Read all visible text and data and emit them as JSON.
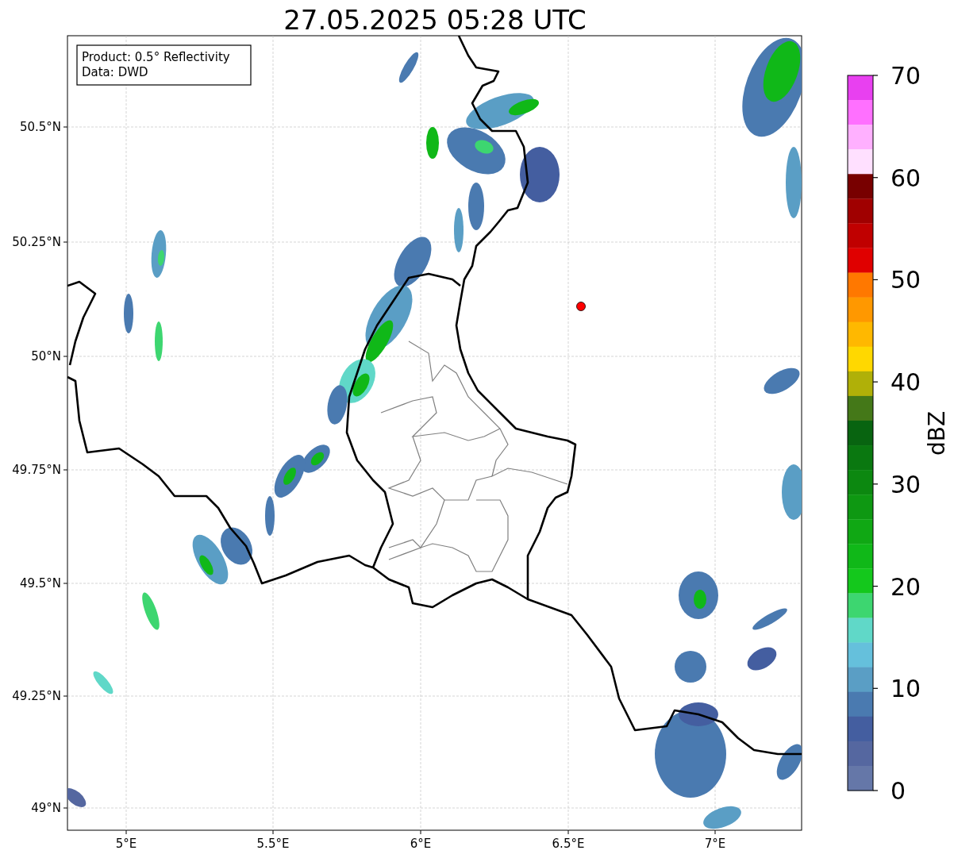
{
  "title": "27.05.2025 05:28 UTC",
  "info_box": {
    "lines": [
      "Product: 0.5° Reflectivity",
      "Data: DWD"
    ]
  },
  "x_ticks": [
    "5°E",
    "5.5°E",
    "6°E",
    "6.5°E",
    "7°E"
  ],
  "y_ticks": [
    "50.5°N",
    "50.25°N",
    "50°N",
    "49.75°N",
    "49.5°N",
    "49.25°N",
    "49°N"
  ],
  "colorbar": {
    "label": "dBZ",
    "ticks": [
      "70",
      "60",
      "50",
      "40",
      "30",
      "20",
      "10",
      "0"
    ],
    "bins": [
      {
        "color": "#e840f0"
      },
      {
        "color": "#ff70ff"
      },
      {
        "color": "#ffb0ff"
      },
      {
        "color": "#ffe0ff"
      },
      {
        "color": "#780000"
      },
      {
        "color": "#a00000"
      },
      {
        "color": "#c00000"
      },
      {
        "color": "#e00000"
      },
      {
        "color": "#ff7800"
      },
      {
        "color": "#ff9800"
      },
      {
        "color": "#ffb800"
      },
      {
        "color": "#ffd800"
      },
      {
        "color": "#b0b008"
      },
      {
        "color": "#447818"
      },
      {
        "color": "#086410"
      },
      {
        "color": "#0a7810"
      },
      {
        "color": "#0c8810"
      },
      {
        "color": "#0e9812"
      },
      {
        "color": "#10a814"
      },
      {
        "color": "#10b818"
      },
      {
        "color": "#14c81c"
      },
      {
        "color": "#3dd670"
      },
      {
        "color": "#60d8c8"
      },
      {
        "color": "#65c0dc"
      },
      {
        "color": "#5a9ec5"
      },
      {
        "color": "#4a7ab0"
      },
      {
        "color": "#445ea0"
      },
      {
        "color": "#5567a0"
      },
      {
        "color": "#6577a8"
      }
    ]
  }
}
